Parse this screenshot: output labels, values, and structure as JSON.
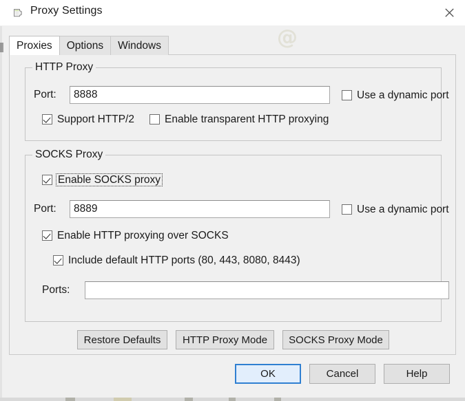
{
  "window": {
    "title": "Proxy Settings",
    "icon": "charles-pitcher-icon",
    "close_label": "×"
  },
  "tabs": [
    {
      "label": "Proxies",
      "selected": true
    },
    {
      "label": "Options",
      "selected": false
    },
    {
      "label": "Windows",
      "selected": false
    }
  ],
  "http_proxy": {
    "group_title": "HTTP Proxy",
    "port_label": "Port:",
    "port_value": "8888",
    "port_placeholder": "",
    "dynamic_port_label": "Use a dynamic port",
    "dynamic_port_checked": false,
    "support_http2_label": "Support HTTP/2",
    "support_http2_checked": true,
    "transparent_label": "Enable transparent HTTP proxying",
    "transparent_checked": false
  },
  "socks_proxy": {
    "group_title": "SOCKS Proxy",
    "enable_label": "Enable SOCKS proxy",
    "enable_checked": true,
    "enable_focused": true,
    "port_label": "Port:",
    "port_value": "8889",
    "port_placeholder": "",
    "dynamic_port_label": "Use a dynamic port",
    "dynamic_port_checked": false,
    "http_over_socks_label": "Enable HTTP proxying over SOCKS",
    "http_over_socks_checked": true,
    "include_default_ports_label": "Include default HTTP ports (80, 443, 8080, 8443)",
    "include_default_ports_checked": true,
    "ports_label": "Ports:",
    "ports_value": "",
    "ports_placeholder": ""
  },
  "mode_buttons": {
    "restore_defaults": "Restore Defaults",
    "http_proxy_mode": "HTTP Proxy Mode",
    "socks_proxy_mode": "SOCKS Proxy Mode"
  },
  "actions": {
    "ok": "OK",
    "cancel": "Cancel",
    "help": "Help",
    "default_button": "OK"
  },
  "watermark": {
    "text": "@"
  },
  "colors": {
    "dialog_background": "#f0f0f0",
    "titlebar_background": "#ffffff",
    "accent_default_button_border": "#2f7fd1",
    "accent_default_button_fill": "#e2eefc",
    "group_border": "#c4c4c4",
    "text": "#1a1a1a",
    "field_background": "#ffffff",
    "button_face": "#e1e1e1"
  }
}
